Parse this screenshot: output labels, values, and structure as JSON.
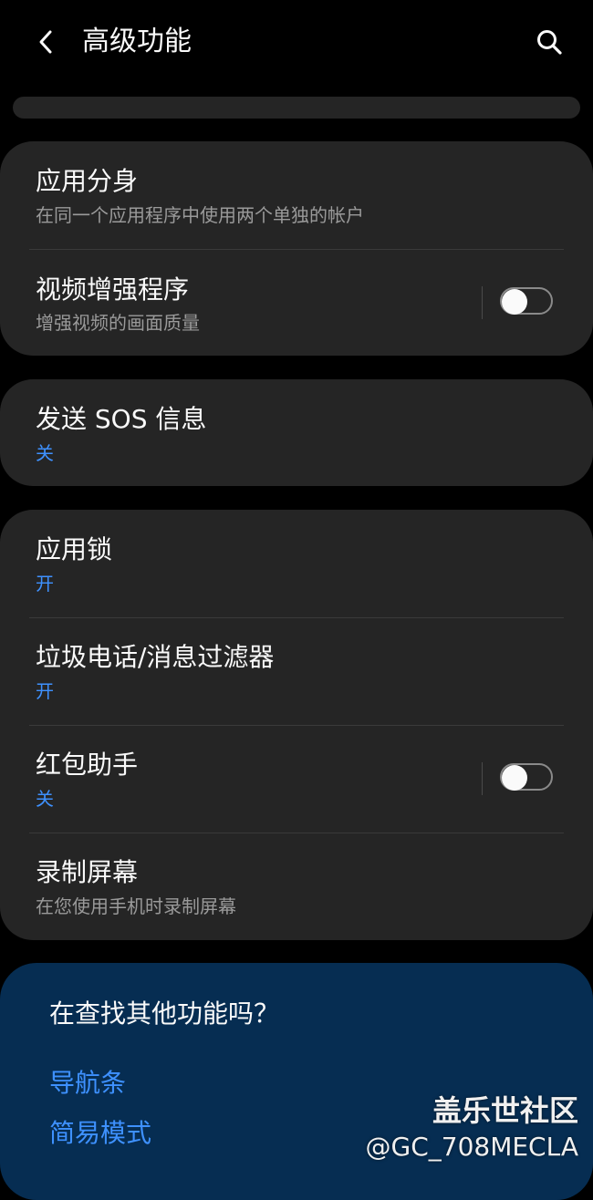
{
  "header": {
    "title": "高级功能"
  },
  "card1": {
    "dual_app": {
      "title": "应用分身",
      "subtitle": "在同一个应用程序中使用两个单独的帐户"
    },
    "video_enhancer": {
      "title": "视频增强程序",
      "subtitle": "增强视频的画面质量",
      "enabled": false
    }
  },
  "card2": {
    "sos": {
      "title": "发送 SOS 信息",
      "status": "关"
    }
  },
  "card3": {
    "app_lock": {
      "title": "应用锁",
      "status": "开"
    },
    "spam_filter": {
      "title": "垃圾电话/消息过滤器",
      "status": "开"
    },
    "red_packet": {
      "title": "红包助手",
      "status": "关",
      "enabled": false
    },
    "screen_record": {
      "title": "录制屏幕",
      "subtitle": "在您使用手机时录制屏幕"
    }
  },
  "suggestions": {
    "title": "在查找其他功能吗？",
    "links": [
      "导航条",
      "简易模式"
    ]
  },
  "watermark": {
    "brand": "盖乐世社区",
    "user": "@GC_708MECLA"
  },
  "colors": {
    "background": "#000000",
    "card": "#252525",
    "accent": "#3e91ff",
    "suggest_bg": "#062d52"
  }
}
